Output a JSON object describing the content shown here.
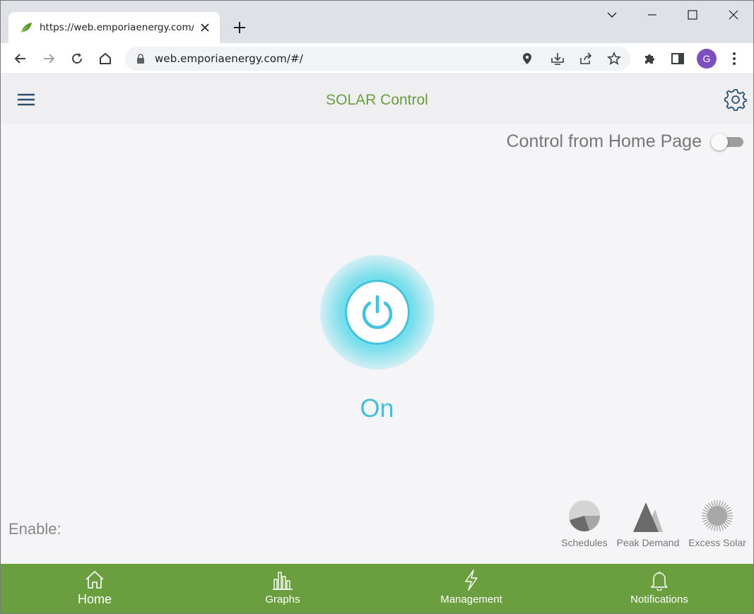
{
  "browser": {
    "tab_title": "https://web.emporiaenergy.com/",
    "url": "web.emporiaenergy.com/#/",
    "profile_initial": "G"
  },
  "header": {
    "title": "SOLAR Control"
  },
  "control": {
    "home_page_label": "Control from Home Page",
    "home_page_enabled": false,
    "state": "On"
  },
  "enable": {
    "label": "Enable:",
    "modes": [
      {
        "label": "Schedules",
        "icon": "pie-icon"
      },
      {
        "label": "Peak Demand",
        "icon": "mountain-icon"
      },
      {
        "label": "Excess Solar",
        "icon": "sun-icon"
      }
    ]
  },
  "nav": {
    "items": [
      {
        "label": "Home",
        "icon": "home-icon",
        "active": true
      },
      {
        "label": "Graphs",
        "icon": "bar-chart-icon"
      },
      {
        "label": "Management",
        "icon": "lightning-icon"
      },
      {
        "label": "Notifications",
        "icon": "bell-icon"
      }
    ]
  },
  "colors": {
    "brand_green": "#6a9e3f",
    "accent_cyan": "#43c0db"
  }
}
